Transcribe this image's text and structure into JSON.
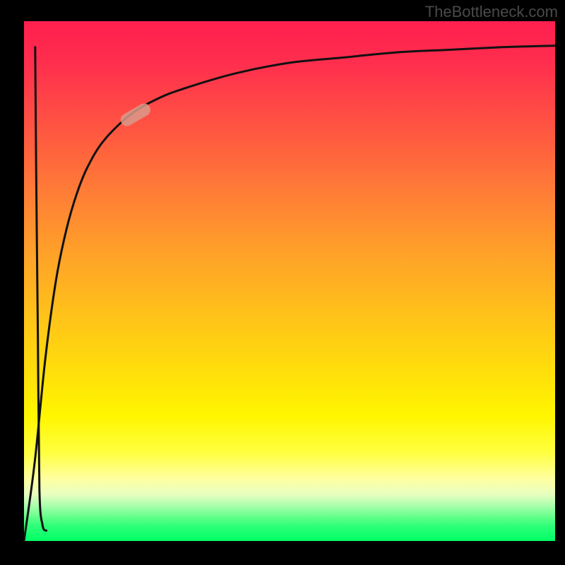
{
  "watermark": "TheBottleneck.com",
  "colors": {
    "page_bg": "#000000",
    "watermark": "#4a4a4a",
    "curve": "#111111",
    "marker": "#d99a8a",
    "gradient_top": "#ff1f4f",
    "gradient_bottom": "#00ff66"
  },
  "chart_data": {
    "type": "line",
    "title": "",
    "xlabel": "",
    "ylabel": "",
    "xlim": [
      0,
      100
    ],
    "ylim": [
      0,
      100
    ],
    "grid": false,
    "legend": false,
    "notes": "Axes are unlabeled; values are normalized 0–100 estimated from pixel positions. A vertical gradient (red→yellow→green) fills the plot area. Two black curves: one near-vertical fall then rise at x≈2–3, and one rising fast then asymptoting near y≈95. A small pill-shaped marker sits on the main curve around (21, 82).",
    "series": [
      {
        "name": "main_curve",
        "x": [
          0,
          2,
          4,
          6,
          8,
          10,
          12,
          15,
          20,
          25,
          30,
          40,
          50,
          60,
          70,
          80,
          90,
          100
        ],
        "y": [
          0,
          15,
          35,
          50,
          60,
          67,
          72,
          77,
          82,
          85,
          87,
          90,
          92,
          93,
          94,
          94.5,
          95,
          95.3
        ]
      },
      {
        "name": "left_spike",
        "x": [
          2.1,
          2.3,
          2.6,
          2.9,
          3.5,
          4.2
        ],
        "y": [
          95,
          70,
          40,
          10,
          3,
          2
        ]
      }
    ],
    "marker": {
      "x": 21,
      "y": 82,
      "angle_deg": 30
    }
  }
}
